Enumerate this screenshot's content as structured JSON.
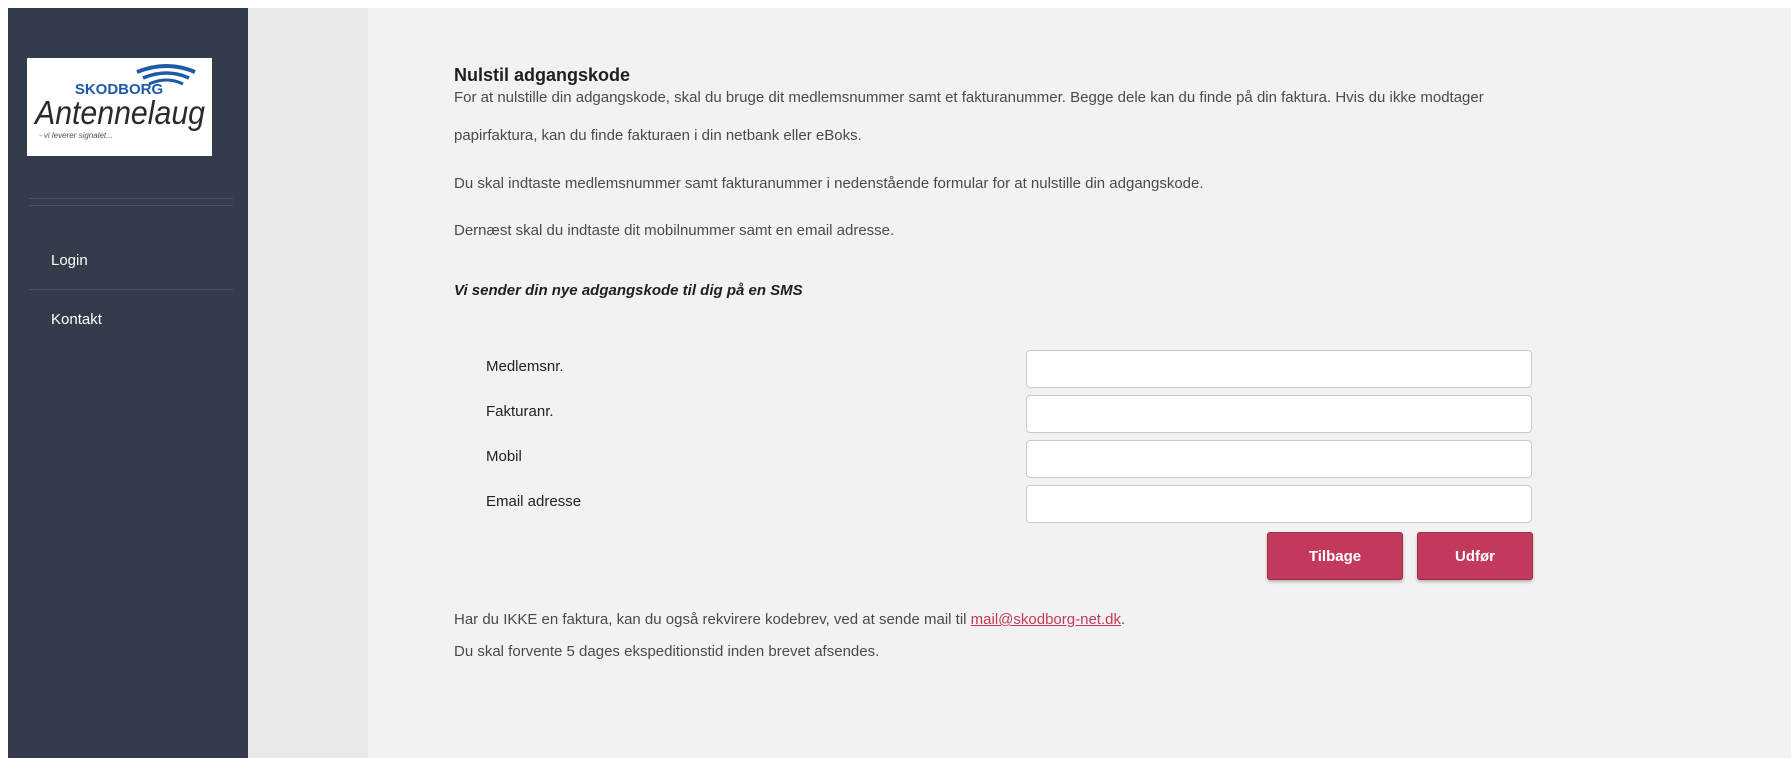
{
  "colors": {
    "sidebar_bg": "#323c4b",
    "gutter_bg": "#e9e9e9",
    "main_bg": "#f3f2f2",
    "accent": "#c3395c",
    "logo_blue": "#1d5aa8"
  },
  "logo": {
    "top": "SKODBORG",
    "main": "Antennelaug",
    "tagline": "- vi leverer signalet..."
  },
  "nav": [
    {
      "label": "Login"
    },
    {
      "label": "Kontakt"
    }
  ],
  "content": {
    "title": "Nulstil adgangskode",
    "para1_line1": "For at nulstille din adgangskode, skal du bruge dit medlemsnummer samt et fakturanummer. Begge dele kan du finde på din faktura. Hvis du ikke modtager",
    "para1_line2": "papirfaktura, kan du finde fakturaen i din netbank eller eBoks.",
    "para2": "Du skal indtaste medlemsnummer samt fakturanummer i nedenstående formular for at nulstille din adgangskode.",
    "para3": "Dernæst skal du indtaste dit mobilnummer samt en email adresse.",
    "sms_note": "Vi sender din nye adgangskode til dig på en SMS"
  },
  "form": {
    "fields": [
      {
        "label": "Medlemsnr.",
        "value": ""
      },
      {
        "label": "Fakturanr.",
        "value": ""
      },
      {
        "label": "Mobil",
        "value": ""
      },
      {
        "label": "Email adresse",
        "value": ""
      }
    ],
    "back_label": "Tilbage",
    "submit_label": "Udfør"
  },
  "footer": {
    "line1_text": "Har du IKKE en faktura, kan du også rekvirere kodebrev, ved at sende mail til",
    "email": "mail@skodborg-net.dk",
    "line1_end": ".",
    "line2": "Du skal forvente 5 dages ekspeditionstid inden brevet afsendes."
  }
}
